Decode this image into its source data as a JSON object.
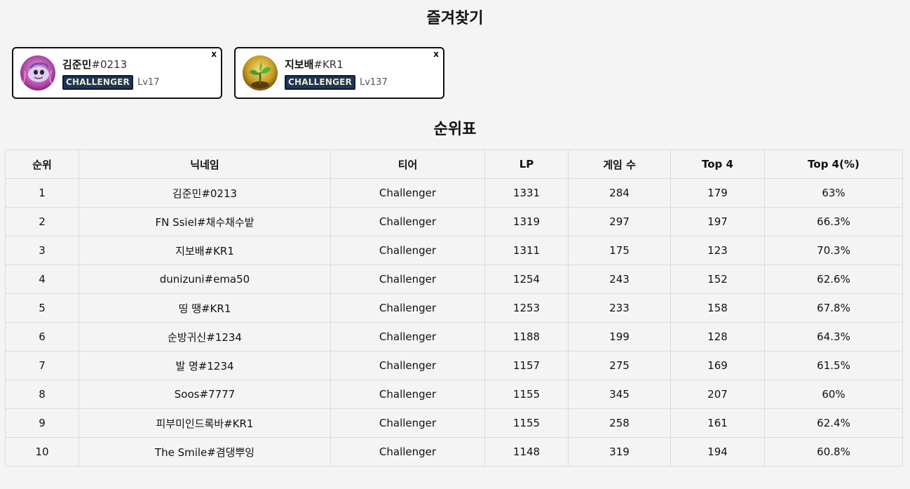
{
  "favorites": {
    "title": "즐겨찾기",
    "close_label": "x",
    "cards": [
      {
        "name": "김준민",
        "tag": "#0213",
        "tier": "CHALLENGER",
        "level": "Lv17",
        "avatar_icon": "poro-avatar-icon"
      },
      {
        "name": "지보배",
        "tag": "#KR1",
        "tier": "CHALLENGER",
        "level": "Lv137",
        "avatar_icon": "sprout-avatar-icon"
      }
    ]
  },
  "ranking": {
    "title": "순위표",
    "headers": [
      "순위",
      "닉네임",
      "티어",
      "LP",
      "게임 수",
      "Top 4",
      "Top 4(%)"
    ],
    "rows": [
      [
        "1",
        "김준민#0213",
        "Challenger",
        "1331",
        "284",
        "179",
        "63%"
      ],
      [
        "2",
        "FN Ssiel#채수채수밭",
        "Challenger",
        "1319",
        "297",
        "197",
        "66.3%"
      ],
      [
        "3",
        "지보배#KR1",
        "Challenger",
        "1311",
        "175",
        "123",
        "70.3%"
      ],
      [
        "4",
        "dunizuni#ema50",
        "Challenger",
        "1254",
        "243",
        "152",
        "62.6%"
      ],
      [
        "5",
        "띵 땡#KR1",
        "Challenger",
        "1253",
        "233",
        "158",
        "67.8%"
      ],
      [
        "6",
        "순방귀신#1234",
        "Challenger",
        "1188",
        "199",
        "128",
        "64.3%"
      ],
      [
        "7",
        "발 명#1234",
        "Challenger",
        "1157",
        "275",
        "169",
        "61.5%"
      ],
      [
        "8",
        "Soos#7777",
        "Challenger",
        "1155",
        "345",
        "207",
        "60%"
      ],
      [
        "9",
        "피부미인드록바#KR1",
        "Challenger",
        "1155",
        "258",
        "161",
        "62.4%"
      ],
      [
        "10",
        "The Smile#겸댕뿌잉",
        "Challenger",
        "1148",
        "319",
        "194",
        "60.8%"
      ]
    ]
  },
  "colors": {
    "badge_bg": "#1d3557",
    "badge_text": "#f1e6c8",
    "card_border": "#111111",
    "background": "#f4f4f4"
  }
}
